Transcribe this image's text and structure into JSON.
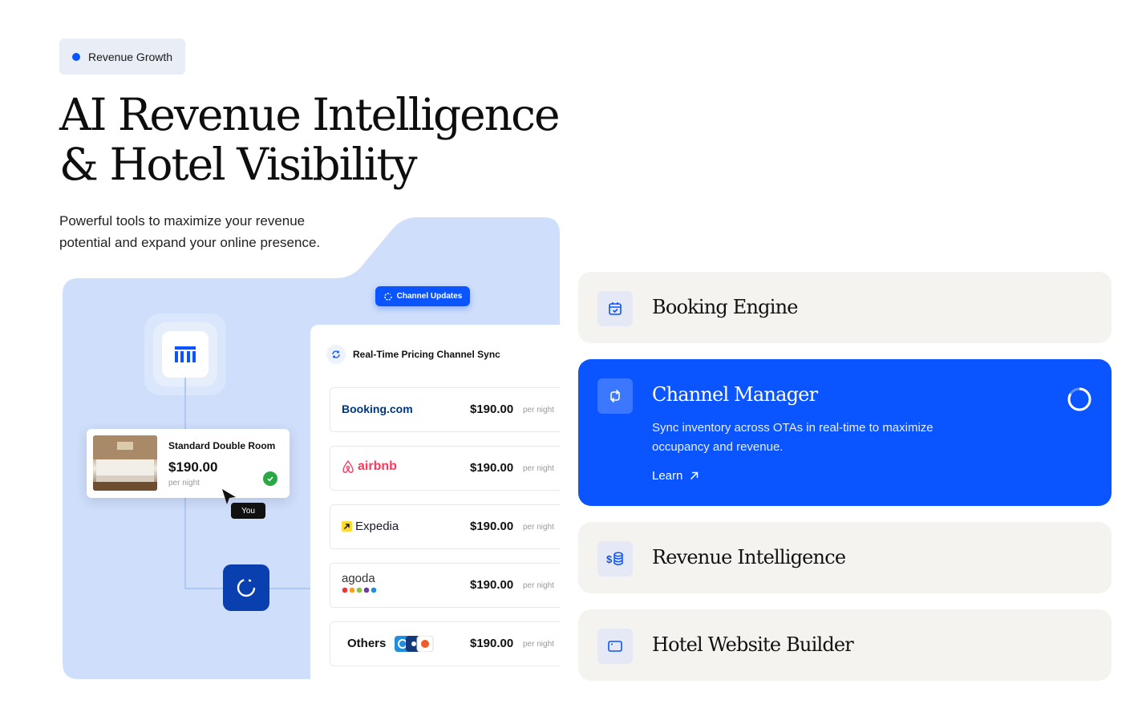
{
  "badge": {
    "label": "Revenue Growth"
  },
  "hero": {
    "title_line1": "AI Revenue Intelligence",
    "title_line2": "& Hotel Visibility",
    "subtitle": "Powerful tools to maximize your revenue potential and expand your online presence."
  },
  "visual": {
    "channel_updates": "Channel Updates",
    "room_card": {
      "title": "Standard Double Room",
      "price": "$190.00",
      "per_night": "per night"
    },
    "cursor_label": "You",
    "sync_title": "Real-Time Pricing Channel Sync",
    "otas": [
      {
        "name": "Booking.com",
        "price": "$190.00",
        "per_night": "per night"
      },
      {
        "name": "airbnb",
        "price": "$190.00",
        "per_night": "per night"
      },
      {
        "name": "Expedia",
        "price": "$190.00",
        "per_night": "per night"
      },
      {
        "name": "agoda",
        "price": "$190.00",
        "per_night": "per night"
      },
      {
        "name": "Others",
        "price": "$190.00",
        "per_night": "per night"
      }
    ]
  },
  "features": [
    {
      "title": "Booking Engine",
      "icon": "calendar-check-icon"
    },
    {
      "title": "Channel Manager",
      "icon": "sync-arrows-icon",
      "description": "Sync inventory across OTAs in real-time to maximize occupancy and revenue.",
      "link": "Learn"
    },
    {
      "title": "Revenue Intelligence",
      "icon": "dollar-coins-icon"
    },
    {
      "title": "Hotel Website Builder",
      "icon": "browser-window-icon"
    }
  ],
  "colors": {
    "accent": "#0a55ff",
    "card_bg": "#f4f3ef",
    "visual_bg": "#cfdefa"
  }
}
